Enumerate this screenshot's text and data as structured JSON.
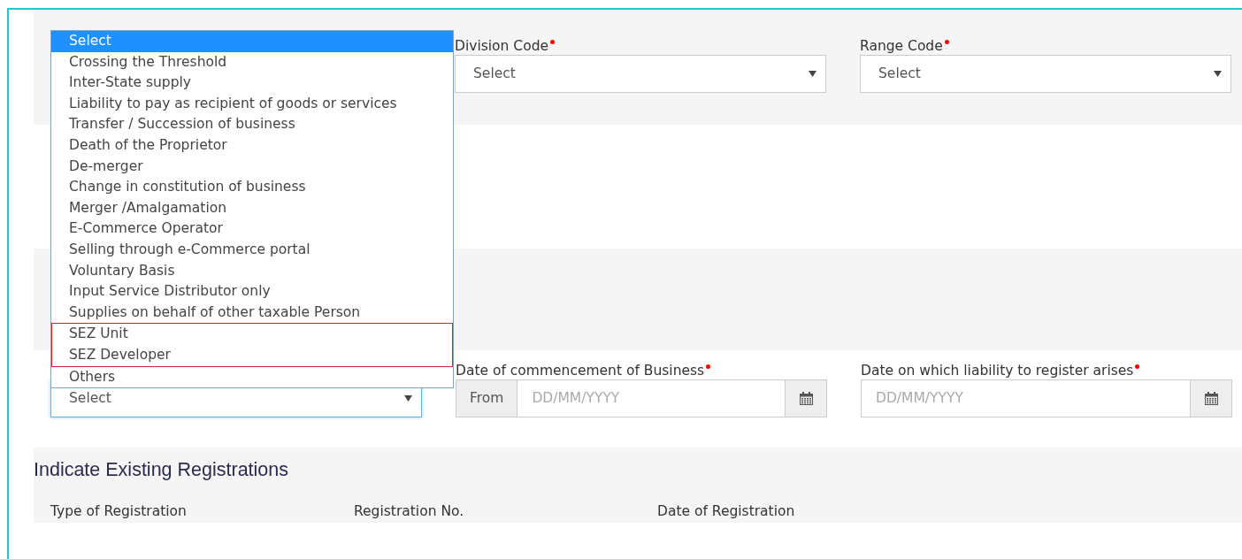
{
  "dropdown": {
    "options": [
      {
        "label": "Select",
        "selected": true,
        "highlighted": false
      },
      {
        "label": "Crossing the Threshold",
        "selected": false,
        "highlighted": false
      },
      {
        "label": "Inter-State supply",
        "selected": false,
        "highlighted": false
      },
      {
        "label": "Liability to pay as recipient of goods or services",
        "selected": false,
        "highlighted": false
      },
      {
        "label": "Transfer / Succession of business",
        "selected": false,
        "highlighted": false
      },
      {
        "label": "Death of the Proprietor",
        "selected": false,
        "highlighted": false
      },
      {
        "label": "De-merger",
        "selected": false,
        "highlighted": false
      },
      {
        "label": "Change in constitution of business",
        "selected": false,
        "highlighted": false
      },
      {
        "label": "Merger /Amalgamation",
        "selected": false,
        "highlighted": false
      },
      {
        "label": "E-Commerce Operator",
        "selected": false,
        "highlighted": false
      },
      {
        "label": "Selling through e-Commerce portal",
        "selected": false,
        "highlighted": false
      },
      {
        "label": "Voluntary Basis",
        "selected": false,
        "highlighted": false
      },
      {
        "label": "Input Service Distributor only",
        "selected": false,
        "highlighted": false
      },
      {
        "label": "Supplies on behalf of other taxable Person",
        "selected": false,
        "highlighted": false
      },
      {
        "label": "SEZ Unit",
        "selected": false,
        "highlighted": true
      },
      {
        "label": "SEZ Developer",
        "selected": false,
        "highlighted": true
      },
      {
        "label": "Others",
        "selected": false,
        "highlighted": false
      }
    ]
  },
  "location_row": {
    "fields": [
      {
        "kind": "select",
        "label": "Division Code",
        "required": true,
        "value": "Select"
      },
      {
        "kind": "select",
        "label": "Range Code",
        "required": true,
        "value": "Select"
      }
    ]
  },
  "dates_row": {
    "fields": [
      {
        "kind": "select",
        "value": "Select",
        "focused": true
      },
      {
        "kind": "date",
        "label": "Date of commencement of Business",
        "required": true,
        "prefix": "From",
        "placeholder": "DD/MM/YYYY"
      },
      {
        "kind": "date",
        "label": "Date on which liability to register arises",
        "required": true,
        "placeholder": "DD/MM/YYYY"
      }
    ]
  },
  "existing_registrations": {
    "title": "Indicate Existing Registrations",
    "columns": [
      "Type of Registration",
      "Registration No.",
      "Date of Registration"
    ]
  }
}
